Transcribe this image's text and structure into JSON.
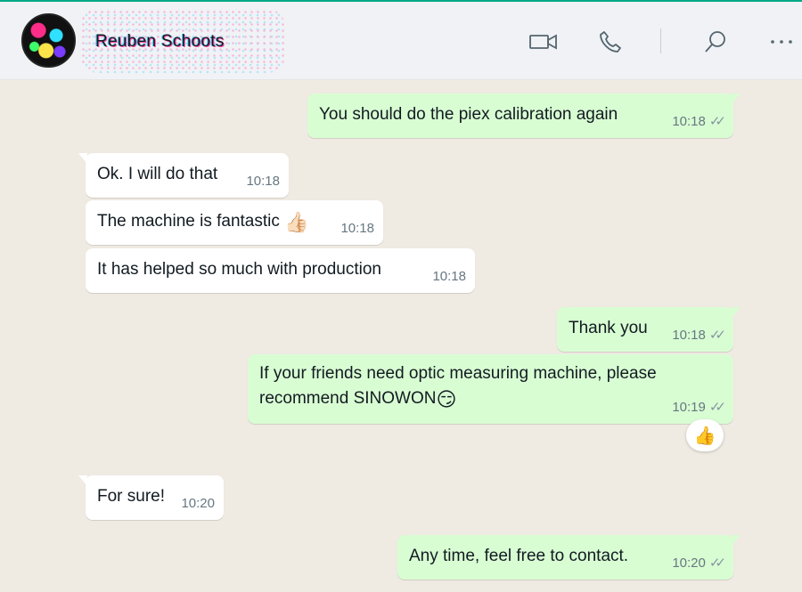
{
  "header": {
    "contact_name": "Reuben Schoots",
    "icons": [
      "video-call-icon",
      "voice-call-icon",
      "search-icon",
      "menu-icon"
    ]
  },
  "messages": [
    {
      "dir": "out",
      "text": "You should do the piex calibration again",
      "time": "10:18",
      "ticks": "✓✓"
    },
    {
      "dir": "in",
      "text": "Ok. I will do that",
      "time": "10:18"
    },
    {
      "dir": "in",
      "text": "The machine is fantastic",
      "emoji": "👍🏻",
      "time": "10:18"
    },
    {
      "dir": "in",
      "text": "It has helped so much with production",
      "time": "10:18"
    },
    {
      "dir": "out",
      "text": "Thank you",
      "time": "10:18",
      "ticks": "✓✓"
    },
    {
      "dir": "out",
      "text_line1": "If your friends need optic measuring machine, please",
      "text_line2": "recommend SINOWON",
      "emoji": "😏",
      "time": "10:19",
      "ticks": "✓✓",
      "reaction": "👍"
    },
    {
      "dir": "in",
      "text": "For sure!",
      "time": "10:20"
    },
    {
      "dir": "out",
      "text": "Any time, feel free to contact.",
      "time": "10:20",
      "ticks": "✓✓"
    }
  ],
  "colors": {
    "accent": "#00a884",
    "outgoing_bubble": "#d9fdd3",
    "incoming_bubble": "#ffffff",
    "chat_background": "#efeae2"
  }
}
